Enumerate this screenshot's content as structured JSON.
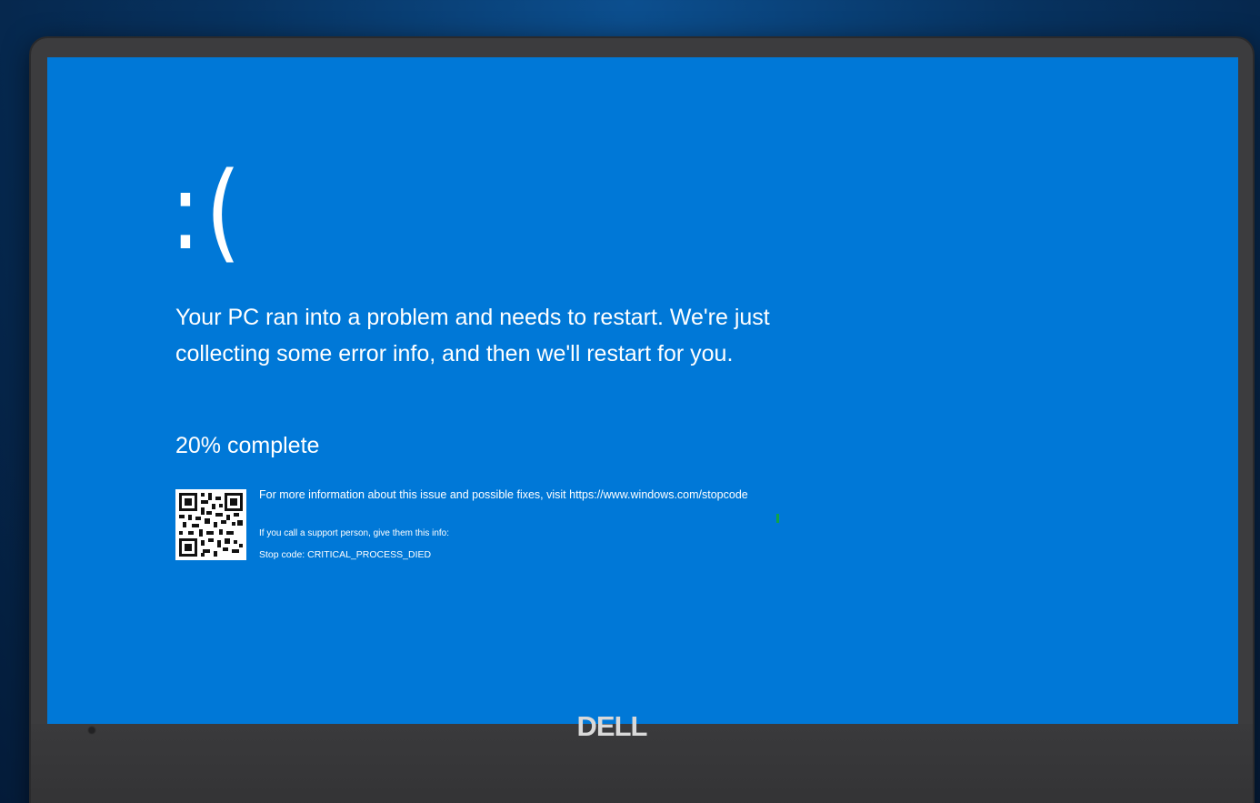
{
  "screen": {
    "sad_face": ":(",
    "message": "Your PC ran into a problem and needs to restart. We're just collecting some error info, and then we'll restart for you.",
    "progress_text": "20% complete",
    "progress_percent": 20,
    "info_text": "For more information about this issue and possible fixes, visit https://www.windows.com/stopcode",
    "support_text": "If you call a support person, give them this info:",
    "stop_code_text": "Stop code: CRITICAL_PROCESS_DIED",
    "qr_icon": "qr-code-icon",
    "background_color": "#0078d7",
    "text_color": "#ffffff"
  },
  "device": {
    "brand_logo": "DELL",
    "webcam_icon": "webcam-icon"
  }
}
